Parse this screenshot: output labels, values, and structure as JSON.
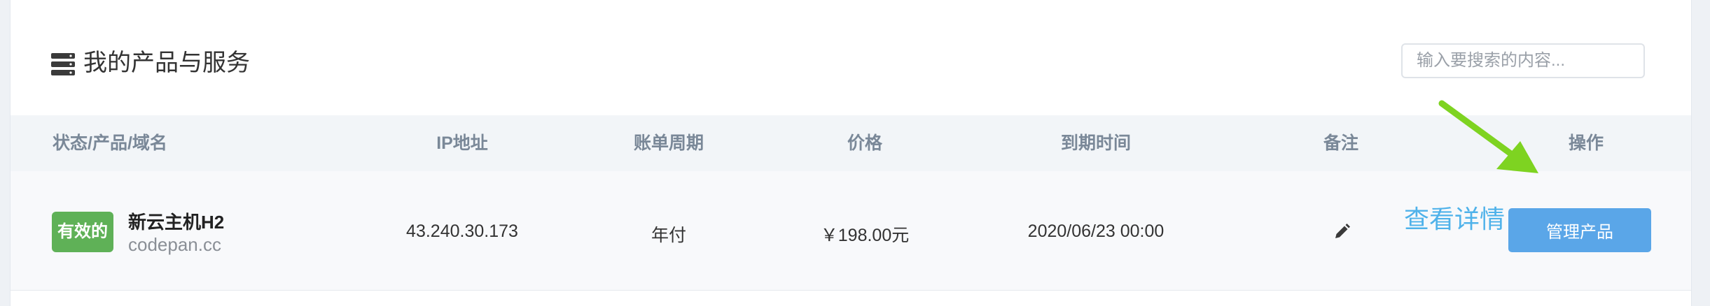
{
  "header": {
    "title": "我的产品与服务",
    "title_icon": "server-icon",
    "search_placeholder": "输入要搜索的内容..."
  },
  "table": {
    "columns": [
      "状态/产品/域名",
      "IP地址",
      "账单周期",
      "价格",
      "到期时间",
      "备注",
      "操作"
    ],
    "rows": [
      {
        "status": "有效的",
        "product": "新云主机H2",
        "domain": "codepan.cc",
        "ip": "43.240.30.173",
        "billing_cycle": "年付",
        "price": "￥198.00元",
        "expiry": "2020/06/23 00:00",
        "note_icon": "pencil-icon",
        "action_label": "管理产品"
      }
    ]
  },
  "annotation": {
    "text": "查看详情",
    "text_color": "#4fb2ea",
    "arrow_color": "#7ed321"
  },
  "colors": {
    "status_active": "#5fb157",
    "primary_button": "#5aa6e8",
    "header_bg": "#f2f5f8"
  }
}
